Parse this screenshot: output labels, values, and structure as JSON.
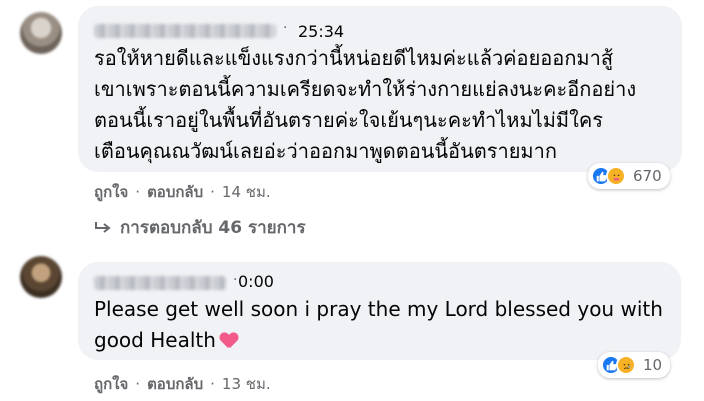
{
  "comments": [
    {
      "time": "25:34",
      "text_lines": [
        "รอให้หายดีและแข็งแรงกว่านี้หน่อยดีไหมค่ะแล้วค่อยออกมาสู้",
        "เขาเพราะตอนนี้ความเครียดจะทำให้ร่างกายแย่ลงนะคะอีกอย่าง",
        "ตอนนี้เราอยู่ในพื้นที่อันตรายค่ะใจเย้นๆนะคะทำไหมไม่มีใคร",
        "เตือนคุณณวัฒน์เลยอ่ะว่าออกมาพูดตอนนี้อันตรายมาก"
      ],
      "reaction_count": "670",
      "reaction_icons": [
        "like-icon",
        "care-icon"
      ],
      "like_label": "ถูกใจ",
      "reply_label": "ตอบกลับ",
      "age": "14 ชม.",
      "replies_label": "การตอบกลับ 46 รายการ"
    },
    {
      "time": "0:00",
      "text": "Please get well soon i pray the my Lord blessed you with good Health",
      "emoji": "pink-heart-emoji",
      "reaction_count": "10",
      "reaction_icons": [
        "like-icon",
        "sad-icon"
      ],
      "like_label": "ถูกใจ",
      "reply_label": "ตอบกลับ",
      "age": "13 ชม."
    }
  ],
  "separator": "·",
  "colors": {
    "bubble_bg": "#f0f2f5",
    "secondary_text": "#65676b",
    "like_blue": "#1877f2",
    "emoji_yellow": "#f7b125",
    "heart_pink": "#f25a8a"
  }
}
